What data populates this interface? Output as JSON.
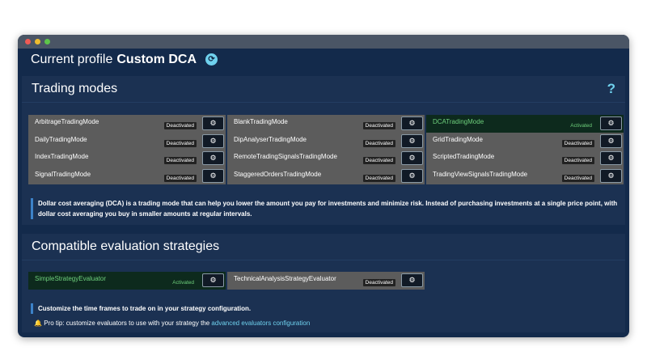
{
  "profile": {
    "label": "Current profile",
    "name": "Custom DCA",
    "refresh_icon": "⟳"
  },
  "trading_modes": {
    "title": "Trading modes",
    "help": "?",
    "modes": [
      {
        "name": "ArbitrageTradingMode",
        "status": "Deactivated",
        "active": false
      },
      {
        "name": "BlankTradingMode",
        "status": "Deactivated",
        "active": false
      },
      {
        "name": "DCATradingMode",
        "status": "Activated",
        "active": true
      },
      {
        "name": "DailyTradingMode",
        "status": "Deactivated",
        "active": false
      },
      {
        "name": "DipAnalyserTradingMode",
        "status": "Deactivated",
        "active": false
      },
      {
        "name": "GridTradingMode",
        "status": "Deactivated",
        "active": false
      },
      {
        "name": "IndexTradingMode",
        "status": "Deactivated",
        "active": false
      },
      {
        "name": "RemoteTradingSignalsTradingMode",
        "status": "Deactivated",
        "active": false
      },
      {
        "name": "ScriptedTradingMode",
        "status": "Deactivated",
        "active": false
      },
      {
        "name": "SignalTradingMode",
        "status": "Deactivated",
        "active": false
      },
      {
        "name": "StaggeredOrdersTradingMode",
        "status": "Deactivated",
        "active": false
      },
      {
        "name": "TradingViewSignalsTradingMode",
        "status": "Deactivated",
        "active": false
      }
    ],
    "description": "Dollar cost averaging (DCA) is a trading mode that can help you lower the amount you pay for investments and minimize risk. Instead of purchasing investments at a single price point, with dollar cost averaging you buy in smaller amounts at regular intervals."
  },
  "strategies": {
    "title": "Compatible evaluation strategies",
    "items": [
      {
        "name": "SimpleStrategyEvaluator",
        "status": "Activated",
        "active": true
      },
      {
        "name": "TechnicalAnalysisStrategyEvaluator",
        "status": "Deactivated",
        "active": false
      }
    ],
    "note": "Customize the time frames to trade on in your strategy configuration.",
    "tip_icon": "🔔",
    "tip_text": "Pro tip: customize evaluators to use with your strategy the",
    "tip_link": "advanced evaluators configuration"
  },
  "icons": {
    "gear": "⚙"
  },
  "colors": {
    "background": "#132a4b",
    "card": "#1b3152",
    "active_green": "#6ed07c",
    "accent": "#6fd1ee"
  }
}
